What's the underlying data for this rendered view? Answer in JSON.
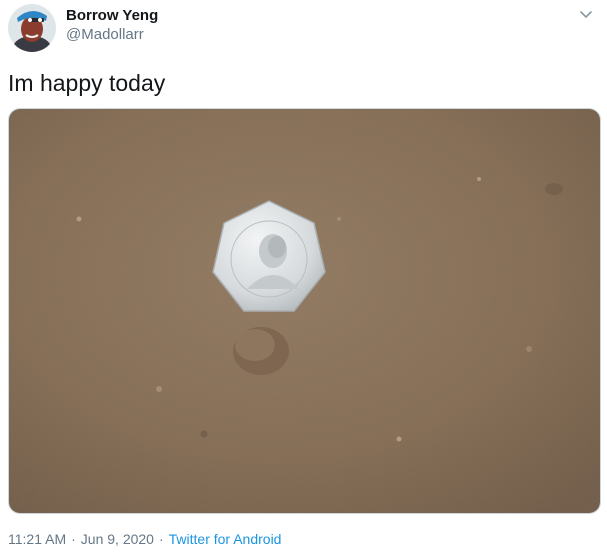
{
  "tweet": {
    "author_name": "Borrow Yeng",
    "author_handle": "@Madollarr",
    "text": "Im happy today",
    "time": "11:21 AM",
    "date": "Jun 9, 2020",
    "separator": "·",
    "source": "Twitter for Android"
  },
  "icons": {
    "avatar": "cartoon-avatar-icon",
    "menu": "chevron-down-icon"
  },
  "colors": {
    "name": "#14171a",
    "secondary": "#657786",
    "link": "#1b95e0",
    "ground": "#8a7158",
    "coin": "#d9dde0"
  }
}
